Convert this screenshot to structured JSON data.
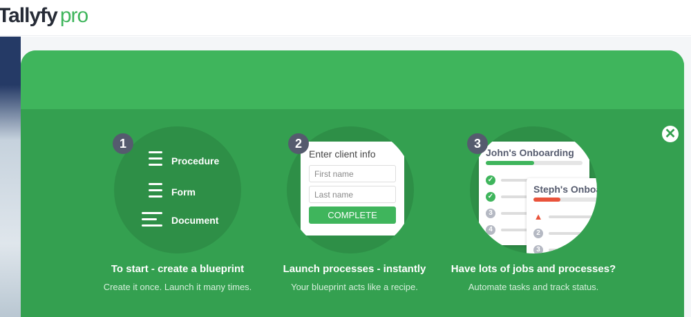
{
  "header": {
    "logo_main": "Tallyfy",
    "logo_suffix": "pro"
  },
  "colors": {
    "brand_green": "#3fb55c",
    "panel_green": "#34a050",
    "dark": "#262b36",
    "alert": "#e9533b"
  },
  "close_icon": "close-circle-icon",
  "steps": [
    {
      "number": "1",
      "title": "To start - create a blueprint",
      "subtitle": "Create it once. Launch it many times.",
      "items": [
        "Procedure",
        "Form",
        "Document"
      ]
    },
    {
      "number": "2",
      "title": "Launch processes - instantly",
      "subtitle": "Your blueprint acts like a recipe.",
      "form": {
        "heading": "Enter client info",
        "first_placeholder": "First name",
        "last_placeholder": "Last name",
        "button": "COMPLETE"
      }
    },
    {
      "number": "3",
      "title": "Have lots of jobs and processes?",
      "subtitle": "Automate tasks and track status.",
      "cards": [
        {
          "title": "John's Onboarding",
          "progress": 0.5,
          "steps": [
            "done",
            "done",
            "3",
            "4"
          ]
        },
        {
          "title": "Steph's Onboarding",
          "progress": 0.35,
          "steps": [
            "alert",
            "2",
            "3"
          ]
        }
      ]
    }
  ]
}
